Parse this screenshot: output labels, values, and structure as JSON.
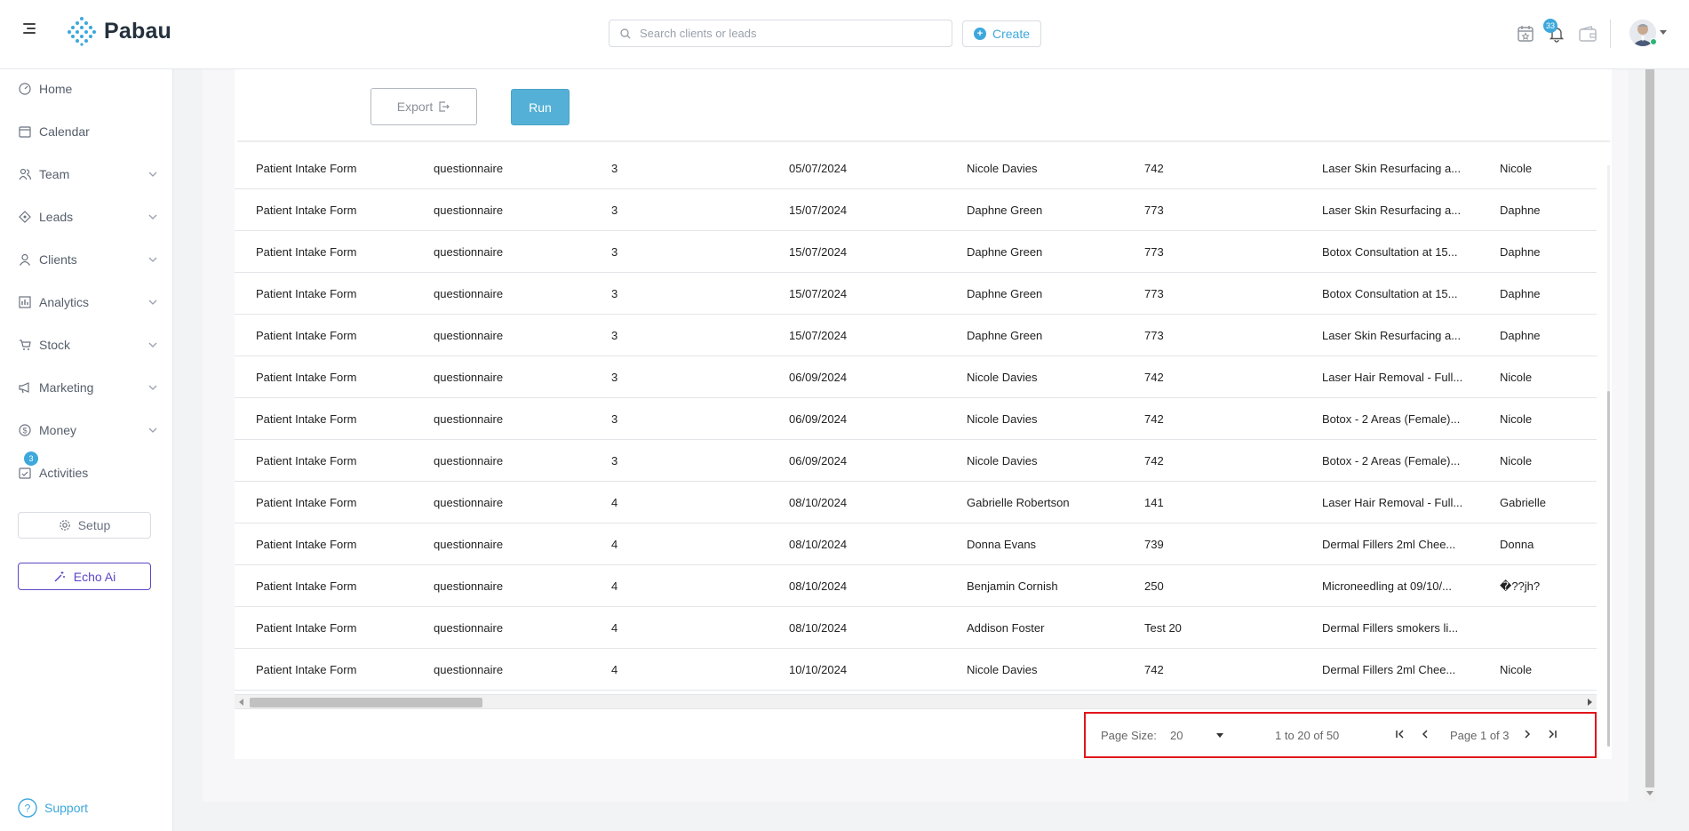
{
  "header": {
    "app_name": "Pabau",
    "search_placeholder": "Search clients or leads",
    "create_label": "Create",
    "notification_count": "33"
  },
  "sidebar": {
    "items": [
      {
        "label": "Home",
        "icon": "dashboard-icon",
        "has_chevron": false
      },
      {
        "label": "Calendar",
        "icon": "calendar-icon",
        "has_chevron": false
      },
      {
        "label": "Team",
        "icon": "team-icon",
        "has_chevron": true
      },
      {
        "label": "Leads",
        "icon": "leads-icon",
        "has_chevron": true
      },
      {
        "label": "Clients",
        "icon": "user-icon",
        "has_chevron": true
      },
      {
        "label": "Analytics",
        "icon": "analytics-icon",
        "has_chevron": true
      },
      {
        "label": "Stock",
        "icon": "cart-icon",
        "has_chevron": true
      },
      {
        "label": "Marketing",
        "icon": "megaphone-icon",
        "has_chevron": true
      },
      {
        "label": "Money",
        "icon": "dollar-icon",
        "has_chevron": true
      },
      {
        "label": "Activities",
        "icon": "activities-icon",
        "has_chevron": false
      }
    ],
    "activities_badge": "3",
    "setup_label": "Setup",
    "echo_label": "Echo Ai",
    "support_label": "Support"
  },
  "toolbar": {
    "export_label": "Export",
    "run_label": "Run"
  },
  "table": {
    "rows": [
      [
        "Patient Intake Form",
        "questionnaire",
        "3",
        "05/07/2024",
        "Nicole Davies",
        "742",
        "Laser Skin Resurfacing a...",
        "Nicole"
      ],
      [
        "Patient Intake Form",
        "questionnaire",
        "3",
        "15/07/2024",
        "Daphne Green",
        "773",
        "Laser Skin Resurfacing a...",
        "Daphne"
      ],
      [
        "Patient Intake Form",
        "questionnaire",
        "3",
        "15/07/2024",
        "Daphne Green",
        "773",
        "Botox Consultation at 15...",
        "Daphne"
      ],
      [
        "Patient Intake Form",
        "questionnaire",
        "3",
        "15/07/2024",
        "Daphne Green",
        "773",
        "Botox Consultation at 15...",
        "Daphne"
      ],
      [
        "Patient Intake Form",
        "questionnaire",
        "3",
        "15/07/2024",
        "Daphne Green",
        "773",
        "Laser Skin Resurfacing a...",
        "Daphne"
      ],
      [
        "Patient Intake Form",
        "questionnaire",
        "3",
        "06/09/2024",
        "Nicole Davies",
        "742",
        "Laser Hair Removal - Full...",
        "Nicole"
      ],
      [
        "Patient Intake Form",
        "questionnaire",
        "3",
        "06/09/2024",
        "Nicole Davies",
        "742",
        "Botox - 2 Areas (Female)...",
        "Nicole"
      ],
      [
        "Patient Intake Form",
        "questionnaire",
        "3",
        "06/09/2024",
        "Nicole Davies",
        "742",
        "Botox - 2 Areas (Female)...",
        "Nicole"
      ],
      [
        "Patient Intake Form",
        "questionnaire",
        "4",
        "08/10/2024",
        "Gabrielle Robertson",
        "141",
        "Laser Hair Removal - Full...",
        "Gabrielle"
      ],
      [
        "Patient Intake Form",
        "questionnaire",
        "4",
        "08/10/2024",
        "Donna Evans",
        "739",
        "Dermal Fillers 2ml Chee...",
        "Donna"
      ],
      [
        "Patient Intake Form",
        "questionnaire",
        "4",
        "08/10/2024",
        "Benjamin Cornish",
        "250",
        "Microneedling at 09/10/...",
        "�??jh?"
      ],
      [
        "Patient Intake Form",
        "questionnaire",
        "4",
        "08/10/2024",
        "Addison Foster",
        "Test 20",
        "Dermal Fillers smokers li...",
        ""
      ],
      [
        "Patient Intake Form",
        "questionnaire",
        "4",
        "10/10/2024",
        "Nicole Davies",
        "742",
        "Dermal Fillers 2ml Chee...",
        "Nicole"
      ]
    ]
  },
  "pagination": {
    "page_size_label": "Page Size:",
    "page_size_value": "20",
    "range_text": "1 to 20 of 50",
    "page_text": "Page 1 of 3"
  },
  "colors": {
    "accent": "#3da8dc",
    "run_button": "#54b0d6",
    "echo_purple": "#5b46c7",
    "highlight_red": "#e0151b"
  }
}
